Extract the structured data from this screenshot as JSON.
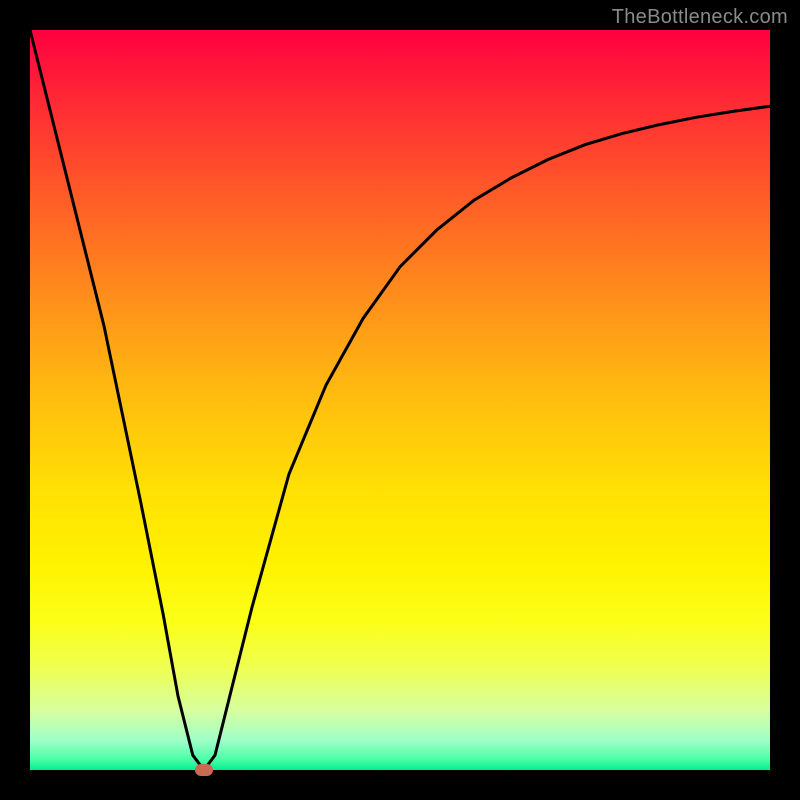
{
  "watermark": "TheBottleneck.com",
  "colors": {
    "frame": "#000000",
    "marker": "#c96b52",
    "curve": "#000000"
  },
  "chart_data": {
    "type": "line",
    "title": "",
    "xlabel": "",
    "ylabel": "",
    "xlim": [
      0,
      100
    ],
    "ylim": [
      0,
      100
    ],
    "grid": false,
    "legend": false,
    "series": [
      {
        "name": "curve",
        "x": [
          0,
          5,
          10,
          15,
          18,
          20,
          22,
          23.5,
          25,
          27,
          30,
          35,
          40,
          45,
          50,
          55,
          60,
          65,
          70,
          75,
          80,
          85,
          90,
          95,
          100
        ],
        "y": [
          100,
          80,
          60,
          36,
          21,
          10,
          2,
          0,
          2,
          10,
          22,
          40,
          52,
          61,
          68,
          73,
          77,
          80,
          82.5,
          84.5,
          86,
          87.2,
          88.2,
          89,
          89.7
        ]
      }
    ],
    "marker": {
      "x": 23.5,
      "y": 0
    }
  }
}
